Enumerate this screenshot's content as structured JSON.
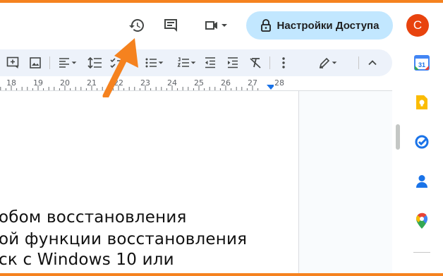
{
  "header": {
    "history_icon": "history-icon",
    "comments_icon": "comment-icon",
    "meet_icon": "videocam-icon",
    "share_label": "Настройки Доступа",
    "avatar_letter": "С"
  },
  "toolbar": {
    "items": [
      "add-comment-icon",
      "insert-image-icon",
      "align-left-icon",
      "line-spacing-icon",
      "checklist-icon",
      "bulleted-list-icon",
      "numbered-list-icon",
      "decrease-indent-icon",
      "increase-indent-icon",
      "clear-formatting-icon",
      "more-vert-icon",
      "edit-mode-icon",
      "collapse-icon"
    ]
  },
  "ruler": {
    "numbers": [
      "18",
      "19",
      "20",
      "21",
      "22",
      "23",
      "24",
      "25",
      "26",
      "27",
      "28"
    ]
  },
  "document": {
    "lines": [
      "обом восстановления",
      "ой функции восстановления",
      "ск с Windows 10 или"
    ]
  },
  "side_panel": {
    "apps": [
      "calendar-icon",
      "keep-icon",
      "tasks-icon",
      "contacts-icon",
      "maps-icon"
    ],
    "calendar_day": "31"
  },
  "colors": {
    "frame": "#f5821f",
    "arrow": "#f5821f",
    "toolbar_bg": "#edf2fa",
    "share_bg": "#c2e7ff",
    "avatar_bg": "#e8430e",
    "icon": "#444746",
    "ruler_marker": "#1a73e8"
  }
}
